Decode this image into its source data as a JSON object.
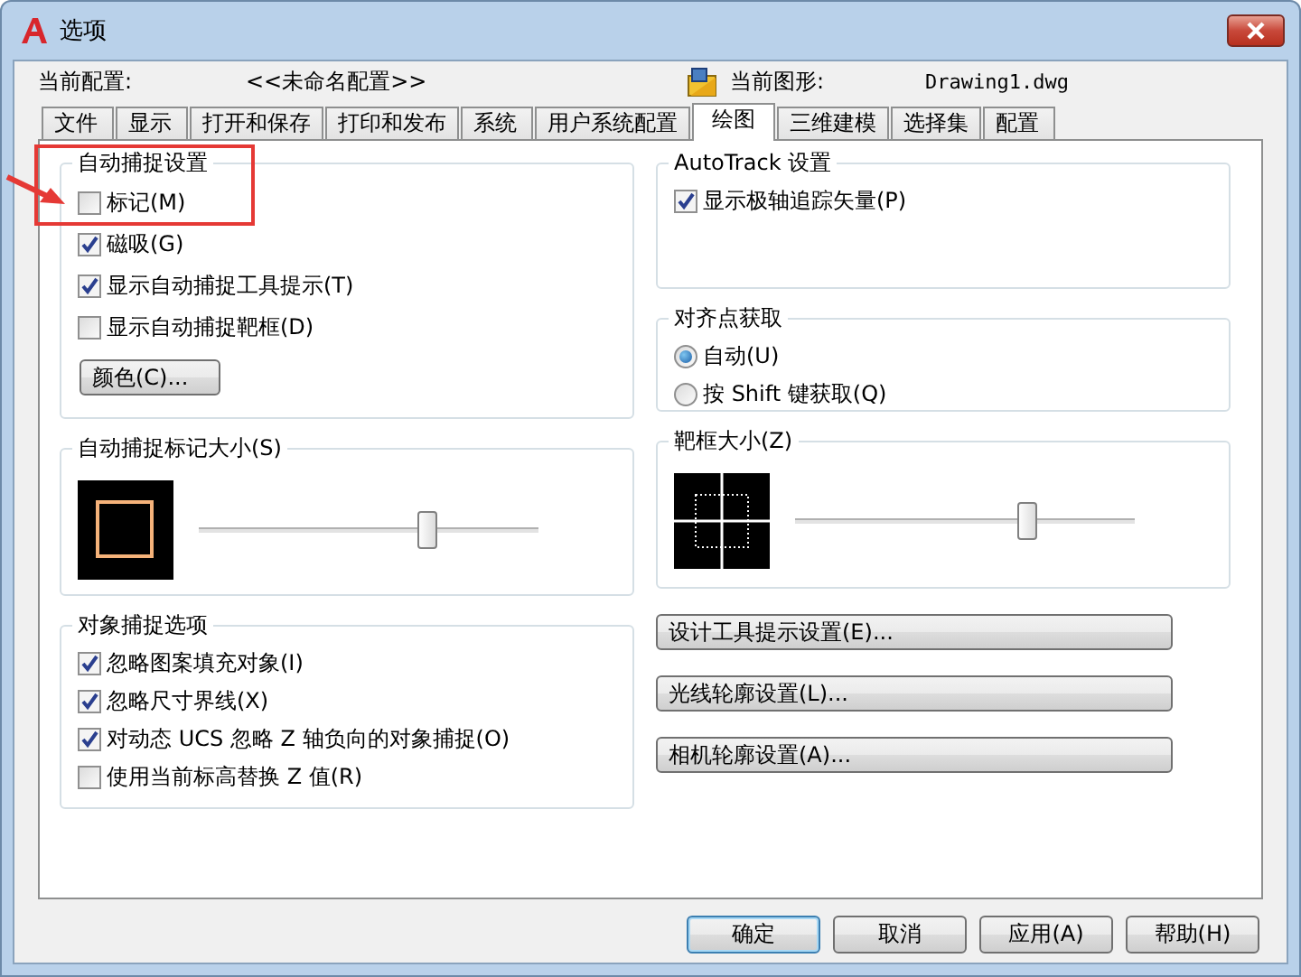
{
  "window": {
    "title": "选项"
  },
  "header": {
    "profile_label": "当前配置:",
    "profile_value": "<<未命名配置>>",
    "drawing_label": "当前图形:",
    "drawing_value": "Drawing1.dwg"
  },
  "tabs": [
    {
      "label": "文件",
      "selected": false
    },
    {
      "label": "显示",
      "selected": false
    },
    {
      "label": "打开和保存",
      "selected": false
    },
    {
      "label": "打印和发布",
      "selected": false
    },
    {
      "label": "系统",
      "selected": false
    },
    {
      "label": "用户系统配置",
      "selected": false
    },
    {
      "label": "绘图",
      "selected": true
    },
    {
      "label": "三维建模",
      "selected": false
    },
    {
      "label": "选择集",
      "selected": false
    },
    {
      "label": "配置",
      "selected": false
    }
  ],
  "autosnap": {
    "title": "自动捕捉设置",
    "highlighted": true,
    "options": [
      {
        "label": "标记(M)",
        "checked": false
      },
      {
        "label": "磁吸(G)",
        "checked": true
      },
      {
        "label": "显示自动捕捉工具提示(T)",
        "checked": true
      },
      {
        "label": "显示自动捕捉靶框(D)",
        "checked": false
      }
    ],
    "color_button": "颜色(C)..."
  },
  "marker_size": {
    "title": "自动捕捉标记大小(S)",
    "level": 0.67
  },
  "object_snap": {
    "title": "对象捕捉选项",
    "options": [
      {
        "label": "忽略图案填充对象(I)",
        "checked": true
      },
      {
        "label": "忽略尺寸界线(X)",
        "checked": true
      },
      {
        "label": "对动态 UCS 忽略 Z 轴负向的对象捕捉(O)",
        "checked": true
      },
      {
        "label": "使用当前标高替换 Z 值(R)",
        "checked": false
      }
    ]
  },
  "autotrack": {
    "title": "AutoTrack 设置",
    "options": [
      {
        "label": "显示极轴追踪矢量(P)",
        "checked": true
      }
    ]
  },
  "alignment": {
    "title": "对齐点获取",
    "options": [
      {
        "label": "自动(U)",
        "selected": true
      },
      {
        "label": "按 Shift 键获取(Q)",
        "selected": false
      }
    ]
  },
  "aperture_size": {
    "title": "靶框大小(Z)",
    "level": 0.68
  },
  "setting_buttons": [
    "设计工具提示设置(E)...",
    "光线轮廓设置(L)...",
    "相机轮廓设置(A)..."
  ],
  "buttons": [
    {
      "label": "确定",
      "default": true
    },
    {
      "label": "取消",
      "default": false
    },
    {
      "label": "应用(A)",
      "default": false
    },
    {
      "label": "帮助(H)",
      "default": false
    }
  ]
}
